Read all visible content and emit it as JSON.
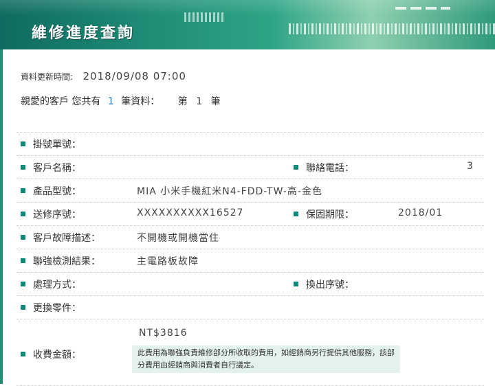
{
  "banner": {
    "title": "維修進度查詢"
  },
  "meta": {
    "update_label": "資料更新時間:",
    "update_value": "2018/09/08 07:00",
    "summary_prefix": "親愛的客戶 您共有",
    "count": "1",
    "summary_mid": "筆資料：",
    "page_prefix": "第",
    "page": "1",
    "page_suffix": "筆"
  },
  "rows": {
    "ticket_no": {
      "label": "掛號單號：",
      "value": ""
    },
    "customer_name": {
      "label": "客戶名稱：",
      "value": ""
    },
    "phone": {
      "label": "聯絡電話：",
      "value": "3"
    },
    "model": {
      "label": "產品型號：",
      "value": "MIA 小米手機紅米N4-FDD-TW-高-金色"
    },
    "serial": {
      "label": "送修序號：",
      "value": "XXXXXXXXXX16527"
    },
    "warranty": {
      "label": "保固期限：",
      "value": "2018/01"
    },
    "fault_desc": {
      "label": "客戶故障描述：",
      "value": "不開機或開機當住"
    },
    "inspection": {
      "label": "聯強檢測結果：",
      "value": "主電路板故障"
    },
    "handling": {
      "label": "處理方式：",
      "value": ""
    },
    "swap_serial": {
      "label": "換出序號：",
      "value": ""
    },
    "parts": {
      "label": "更換零件：",
      "value": ""
    },
    "fee": {
      "label": "收費金額：",
      "value": "NT$3816",
      "note": "此費用為聯強負責維修部分所收取的費用，如經銷商另行提供其他服務，該部分費用由經銷商與消費者自行議定。"
    }
  },
  "colors": {
    "accent": "#0d8a78",
    "banner": "#1f8c76",
    "note_bg": "#e4f2ef",
    "count": "#0070c0"
  }
}
